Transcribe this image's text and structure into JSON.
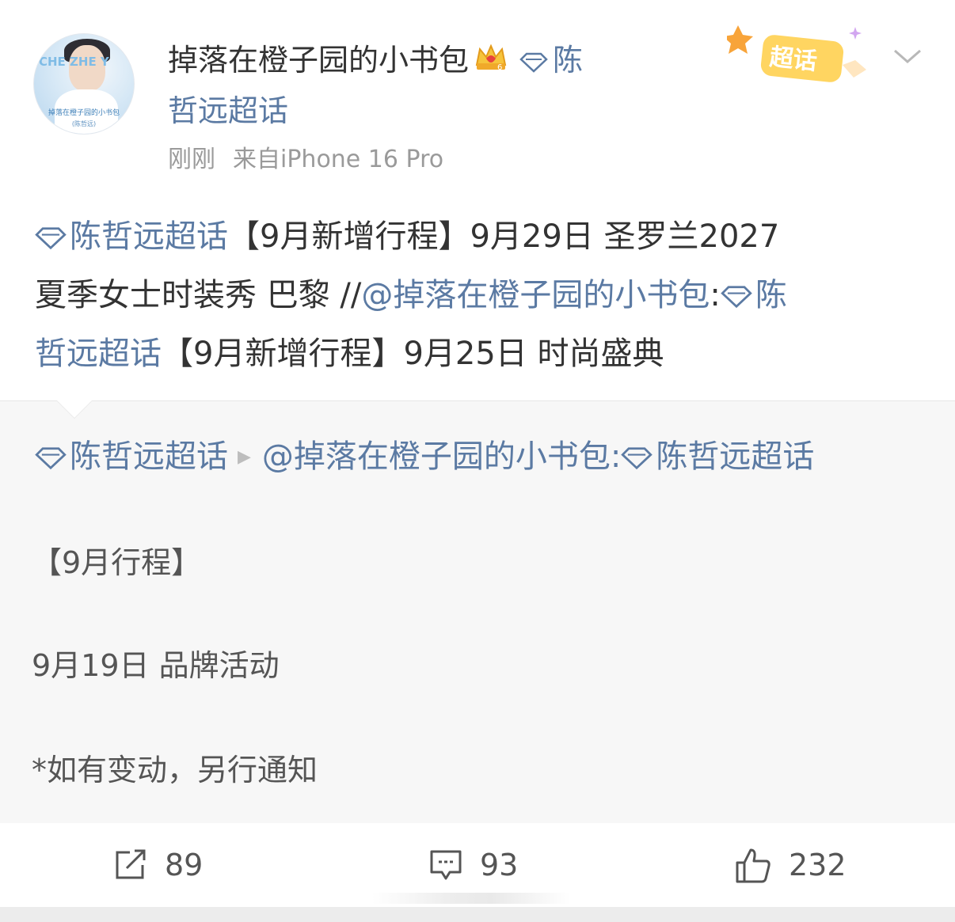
{
  "post": {
    "username": "掉落在橙子园的小书包",
    "topic_tag_part1": "陈",
    "topic_tag_part2": "哲远超话",
    "time": "刚刚",
    "source": "来自iPhone 16 Pro",
    "badge_label": "超话"
  },
  "avatar": {
    "side_text": "CHE ZHE Y",
    "band_text": "掉落在橙子园的小书包",
    "small_text": "(陈哲远)"
  },
  "content": {
    "topic1": "陈哲远超话",
    "text1": "【9月新增行程】9月29日 圣罗兰2027",
    "text2": "夏季女士时装秀 巴黎 //",
    "mention": "@掉落在橙子园的小书包",
    "colon": ":",
    "topic2_a": "陈",
    "topic2_b": "哲远超话",
    "text3": "【9月新增行程】9月25日 时尚盛典"
  },
  "retweet": {
    "topic": "陈哲远超话",
    "arrow": "▶",
    "mention": "@掉落在橙子园的小书包:",
    "topic2": "陈哲远超话",
    "line1": "【9月行程】",
    "line2": "9月19日 品牌活动",
    "line3": "*如有变动，另行通知"
  },
  "actions": {
    "repost_count": "89",
    "comment_count": "93",
    "like_count": "232"
  },
  "colors": {
    "link": "#5b7aa3",
    "text": "#333333",
    "meta": "#9a9a9a",
    "retweet_bg": "#f7f7f7"
  },
  "icons": [
    "share-icon",
    "comment-icon",
    "like-icon",
    "crown-badge-icon",
    "diamond-topic-icon",
    "chevron-down-icon"
  ]
}
